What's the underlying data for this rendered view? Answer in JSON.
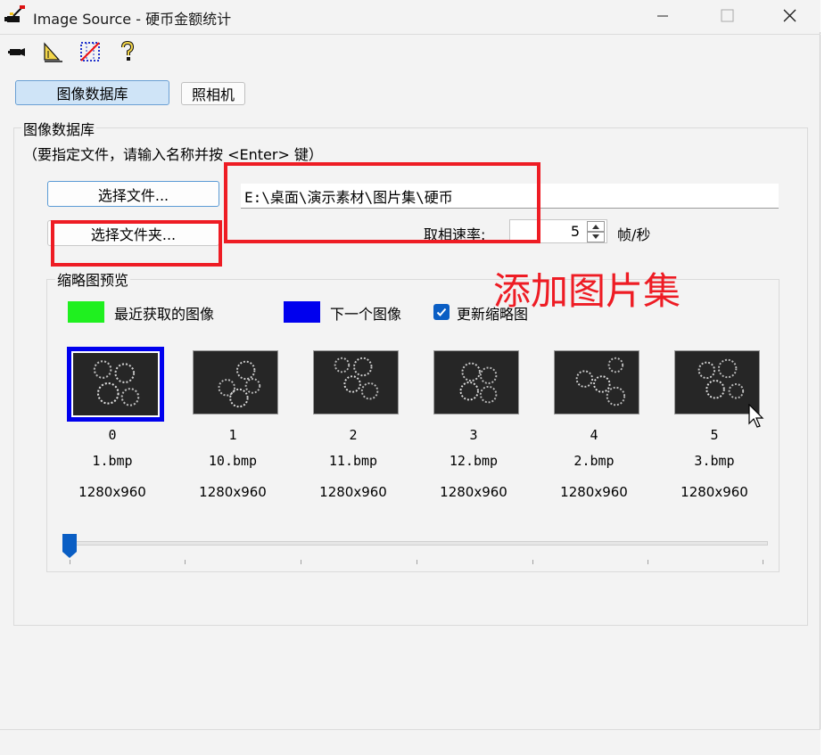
{
  "window": {
    "title": "Image Source - 硬币金额统计"
  },
  "toolbar": {
    "icons": [
      "camera-icon",
      "measure-icon",
      "grid-icon",
      "help-icon"
    ]
  },
  "tabs": [
    {
      "label": "图像数据库",
      "active": true
    },
    {
      "label": "照相机",
      "active": false
    }
  ],
  "group": {
    "title": "图像数据库",
    "hint": "（要指定文件，请输入名称并按 <Enter> 键）",
    "select_file_label": "选择文件...",
    "select_folder_label": "选择文件夹...",
    "path_value": "E:\\桌面\\演示素材\\图片集\\硬币",
    "rate_label": "取相速率:",
    "rate_value": "5",
    "rate_unit": "帧/秒"
  },
  "thumbnails": {
    "title": "缩略图预览",
    "legend_recent": "最近获取的图像",
    "legend_next": "下一个图像",
    "update_label": "更新缩略图",
    "update_checked": true,
    "colors": {
      "recent": "#1ff01f",
      "next": "#0000ee"
    },
    "items": [
      {
        "index": "0",
        "name": "1.bmp",
        "size": "1280x960"
      },
      {
        "index": "1",
        "name": "10.bmp",
        "size": "1280x960"
      },
      {
        "index": "2",
        "name": "11.bmp",
        "size": "1280x960"
      },
      {
        "index": "3",
        "name": "12.bmp",
        "size": "1280x960"
      },
      {
        "index": "4",
        "name": "2.bmp",
        "size": "1280x960"
      },
      {
        "index": "5",
        "name": "3.bmp",
        "size": "1280x960"
      }
    ],
    "slider_position": 0
  },
  "annotation": {
    "text": "添加图片集",
    "color": "#ee1c24"
  }
}
